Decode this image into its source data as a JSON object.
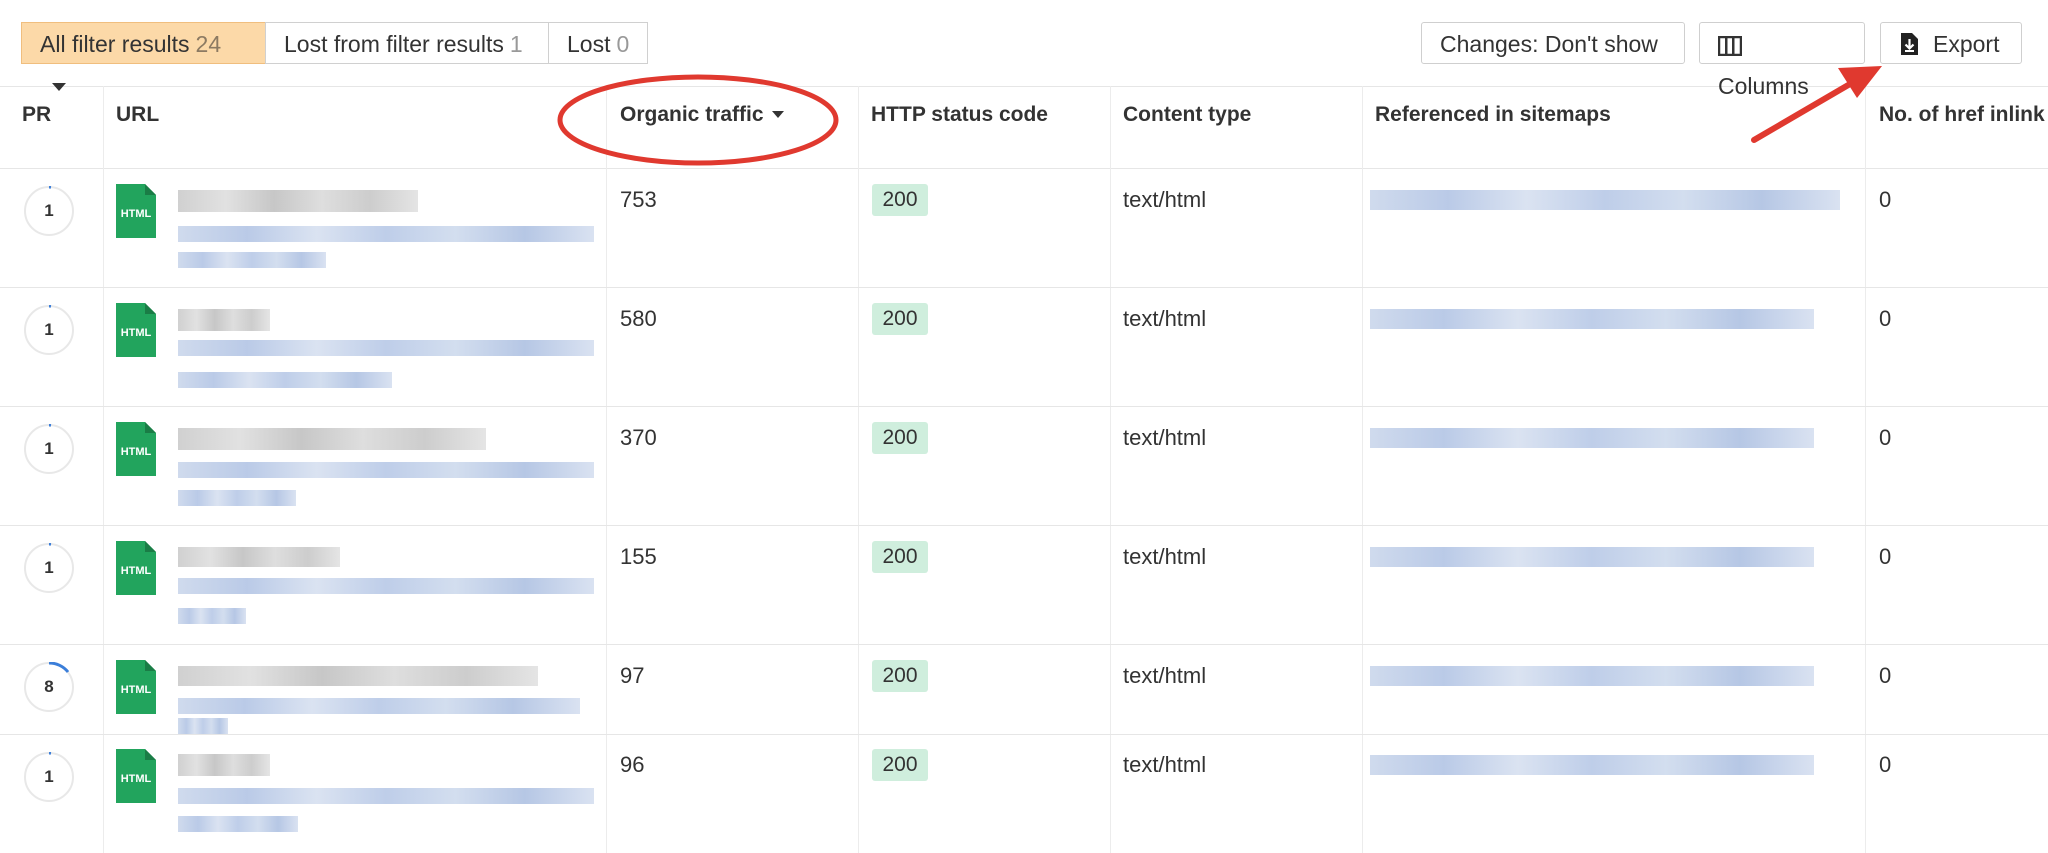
{
  "toolbar": {
    "filters": [
      {
        "label": "All filter results",
        "count": "24"
      },
      {
        "label": "Lost from filter results",
        "count": "1"
      },
      {
        "label": "Lost",
        "count": "0"
      }
    ],
    "changes_label": "Changes: Don't show",
    "columns_label": "Columns",
    "export_label": "Export"
  },
  "table": {
    "headers": [
      "PR",
      "URL",
      "Organic traffic",
      "HTTP status code",
      "Content type",
      "Referenced in sitemaps",
      "No. of href inlink"
    ],
    "sorted_column": "Organic traffic",
    "file_icon_text": "HTML",
    "rows": [
      {
        "pr": "1",
        "traffic": "753",
        "status": "200",
        "content_type": "text/html",
        "inlinks": "0"
      },
      {
        "pr": "1",
        "traffic": "580",
        "status": "200",
        "content_type": "text/html",
        "inlinks": "0"
      },
      {
        "pr": "1",
        "traffic": "370",
        "status": "200",
        "content_type": "text/html",
        "inlinks": "0"
      },
      {
        "pr": "1",
        "traffic": "155",
        "status": "200",
        "content_type": "text/html",
        "inlinks": "0"
      },
      {
        "pr": "8",
        "traffic": "97",
        "status": "200",
        "content_type": "text/html",
        "inlinks": "0"
      },
      {
        "pr": "1",
        "traffic": "96",
        "status": "200",
        "content_type": "text/html",
        "inlinks": "0"
      }
    ]
  },
  "colors": {
    "active_filter": "#fcd9a8",
    "status_badge": "#cfeedd",
    "file_icon": "#22a45d",
    "annotation": "#e0392f"
  }
}
